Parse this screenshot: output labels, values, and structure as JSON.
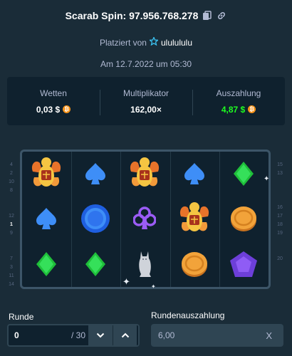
{
  "header": {
    "title": "Scarab Spin: 97.956.768.278",
    "placed_by_prefix": "Platziert von",
    "username": "ululululu",
    "date": "Am 12.7.2022 um 05:30"
  },
  "stats": {
    "bet_label": "Wetten",
    "bet_value": "0,03 $",
    "multiplier_label": "Multiplikator",
    "multiplier_value": "162,00×",
    "payout_label": "Auszahlung",
    "payout_value": "4,87 $",
    "currency_icon": "bitcoin-icon",
    "payout_color": "#1fff20"
  },
  "paylines": {
    "left": [
      "4",
      "2",
      "10",
      "8",
      "",
      "",
      "12",
      "1",
      "9",
      "",
      "",
      "7",
      "3",
      "11",
      "14"
    ],
    "right": [
      "15",
      "13",
      "",
      "",
      "",
      "16",
      "17",
      "18",
      "19",
      "",
      "",
      "20",
      "",
      "",
      ""
    ],
    "active_left": "1"
  },
  "reels": [
    [
      "scarab",
      "spade-blue",
      "diamond-green"
    ],
    [
      "spade-blue",
      "coin-blue",
      "diamond-green"
    ],
    [
      "scarab",
      "club-purple",
      "cat-statue"
    ],
    [
      "spade-blue",
      "scarab",
      "coin-gold"
    ],
    [
      "diamond-green",
      "coin-gold",
      "pentagon-gem-purple"
    ]
  ],
  "round": {
    "label": "Runde",
    "value": "0",
    "total": "/ 30"
  },
  "round_payout": {
    "label": "Rundenauszahlung",
    "value": "6,00",
    "clear": "X"
  }
}
